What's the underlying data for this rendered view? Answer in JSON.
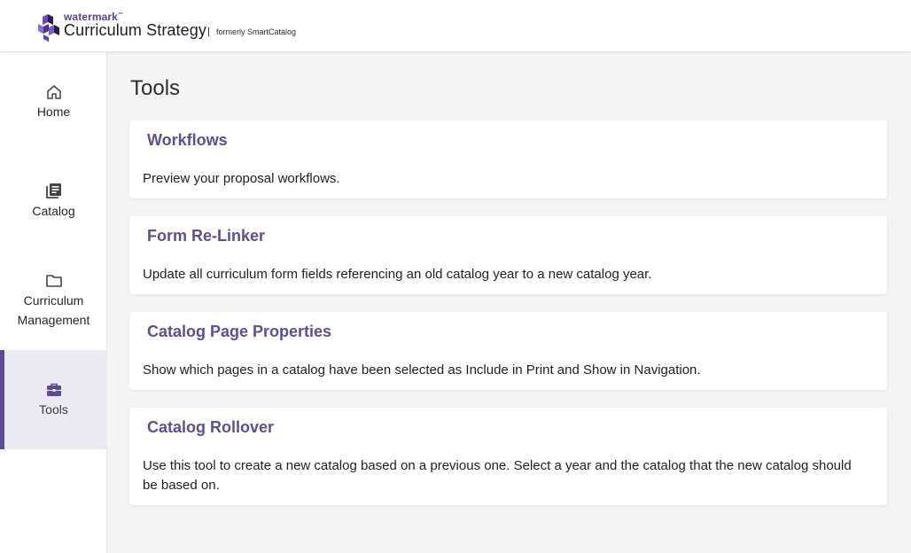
{
  "brand": {
    "company": "watermark",
    "trademark": "™",
    "product": "Curriculum Strategy",
    "formerly": "formerly SmartCatalog",
    "accent_color": "#5b3f99"
  },
  "sidebar": {
    "items": [
      {
        "label": "Home",
        "icon": "home-icon",
        "active": false
      },
      {
        "label": "Catalog",
        "icon": "catalog-icon",
        "active": false
      },
      {
        "label": "Curriculum Management",
        "icon": "folder-icon",
        "active": false
      },
      {
        "label": "Tools",
        "icon": "toolbox-icon",
        "active": true
      }
    ]
  },
  "page": {
    "title": "Tools"
  },
  "tools": [
    {
      "title": "Workflows",
      "description": "Preview your proposal workflows."
    },
    {
      "title": "Form Re-Linker",
      "description": "Update all curriculum form fields referencing an old catalog year to a new catalog year."
    },
    {
      "title": "Catalog Page Properties",
      "description": "Show which pages in a catalog have been selected as Include in Print and Show in Navigation."
    },
    {
      "title": "Catalog Rollover",
      "description": "Use this tool to create a new catalog based on a previous one. Select a year and the catalog that the new catalog should be based on."
    }
  ]
}
